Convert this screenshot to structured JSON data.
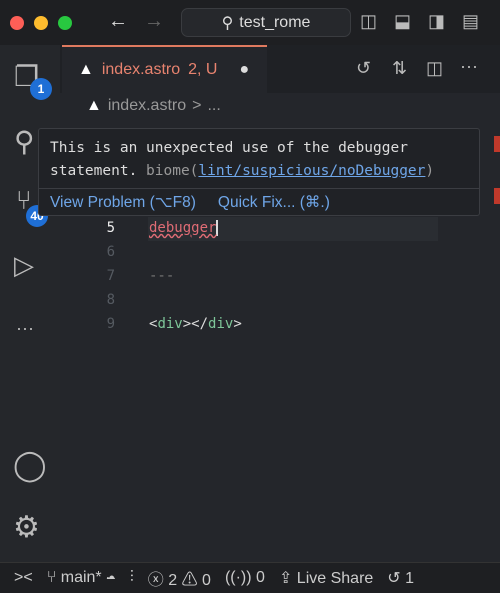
{
  "window": {
    "search_text": "test_rome"
  },
  "activity": {
    "explorer_badge": "1",
    "scm_badge": "40"
  },
  "tab": {
    "filename": "index.astro",
    "status": "2, U"
  },
  "breadcrumb": {
    "file": "index.astro",
    "sep": ">",
    "more": "..."
  },
  "hover": {
    "line1": "This is an unexpected use of the debugger",
    "line2_prefix": "statement. ",
    "source": "biome(",
    "rule": "lint/suspicious/noDebugger",
    "close": ")",
    "view_problem": "View Problem (⌥F8)",
    "quick_fix": "Quick Fix... (⌘.)"
  },
  "code": {
    "lines": [
      {
        "n": "5",
        "text": "debugger"
      },
      {
        "n": "6",
        "text": ""
      },
      {
        "n": "7",
        "text": "---"
      },
      {
        "n": "8",
        "text": ""
      },
      {
        "n": "9",
        "open": "<",
        "tag": "div",
        "mid": "></",
        "tag2": "div",
        "close": ">"
      }
    ]
  },
  "status": {
    "branch": "main*",
    "errors": "2",
    "warnings": "0",
    "ports": "0",
    "live_share": "Live Share",
    "history": "1"
  },
  "colors": {
    "accent": "#e07a5f",
    "link": "#6fa6e8",
    "error": "#e06c75",
    "badge": "#1f6fd6"
  }
}
